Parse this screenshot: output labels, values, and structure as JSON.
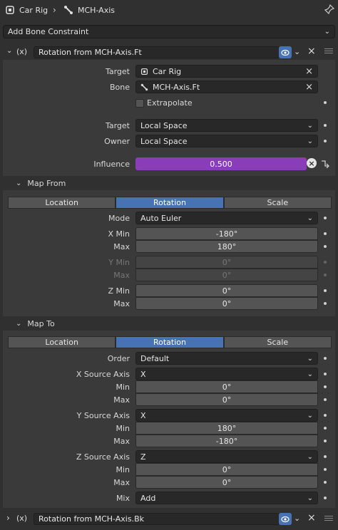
{
  "breadcrumb": {
    "object": "Car Rig",
    "bone": "MCH-Axis"
  },
  "add_constraint_label": "Add Bone Constraint",
  "constraint1": {
    "name": "Rotation from MCH-Axis.Ft",
    "target_label": "Target",
    "target_value": "Car Rig",
    "bone_label": "Bone",
    "bone_value": "MCH-Axis.Ft",
    "extrapolate_label": "Extrapolate",
    "target_space_label": "Target",
    "target_space_value": "Local Space",
    "owner_space_label": "Owner",
    "owner_space_value": "Local Space",
    "influence_label": "Influence",
    "influence_value": "0.500",
    "influence_fraction": 0.5
  },
  "map_from": {
    "title": "Map From",
    "tabs": [
      "Location",
      "Rotation",
      "Scale"
    ],
    "active_tab": "Rotation",
    "mode_label": "Mode",
    "mode_value": "Auto Euler",
    "x_min_label": "X Min",
    "x_min": "-180°",
    "x_max_label": "Max",
    "x_max": "180°",
    "y_min_label": "Y Min",
    "y_min": "0°",
    "y_max_label": "Max",
    "y_max": "0°",
    "z_min_label": "Z Min",
    "z_min": "0°",
    "z_max_label": "Max",
    "z_max": "0°"
  },
  "map_to": {
    "title": "Map To",
    "tabs": [
      "Location",
      "Rotation",
      "Scale"
    ],
    "active_tab": "Rotation",
    "order_label": "Order",
    "order_value": "Default",
    "x_source_label": "X Source Axis",
    "x_source_value": "X",
    "x_min_label": "Min",
    "x_min": "0°",
    "x_max_label": "Max",
    "x_max": "0°",
    "y_source_label": "Y Source Axis",
    "y_source_value": "X",
    "y_min_label": "Min",
    "y_min": "180°",
    "y_max_label": "Max",
    "y_max": "-180°",
    "z_source_label": "Z Source Axis",
    "z_source_value": "Z",
    "z_min_label": "Min",
    "z_min": "0°",
    "z_max_label": "Max",
    "z_max": "0°",
    "mix_label": "Mix",
    "mix_value": "Add"
  },
  "constraint2": {
    "name": "Rotation from MCH-Axis.Bk"
  },
  "colors": {
    "accent": "#4772b3",
    "influence": "#8a3db8",
    "panel": "#3a3a3a",
    "background": "#303030"
  }
}
